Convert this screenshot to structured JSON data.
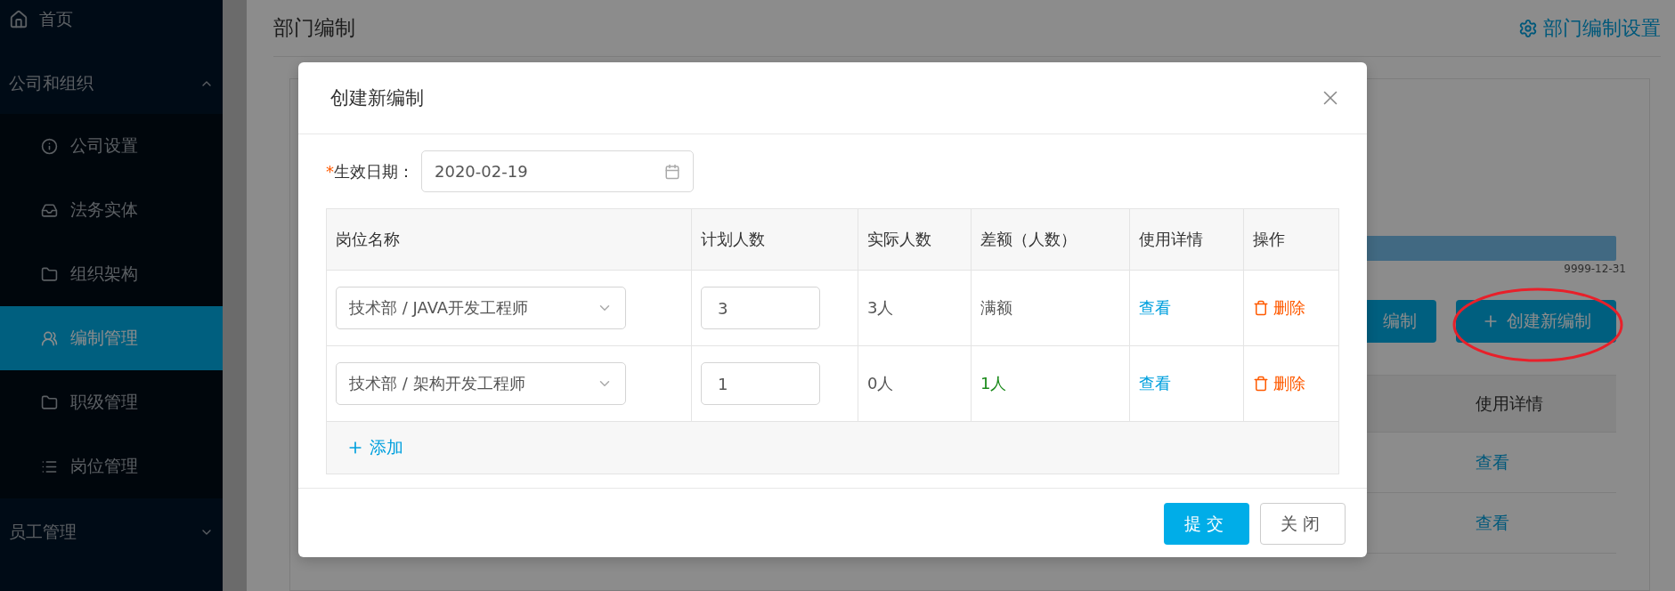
{
  "sidebar": {
    "items": [
      {
        "kind": "link",
        "label": "首页",
        "selected": false
      },
      {
        "kind": "group",
        "label": "公司和组织",
        "expanded": true,
        "children": [
          {
            "label": "公司设置",
            "selected": false
          },
          {
            "label": "法务实体",
            "selected": false
          },
          {
            "label": "组织架构",
            "selected": false
          },
          {
            "label": "编制管理",
            "selected": true
          },
          {
            "label": "职级管理",
            "selected": false
          },
          {
            "label": "岗位管理",
            "selected": false
          }
        ]
      },
      {
        "kind": "group",
        "label": "员工管理",
        "expanded": false
      }
    ]
  },
  "page": {
    "title": "部门编制",
    "settings_link": "部门编制设置",
    "timeline_end": "9999-12-31",
    "buttons": [
      "编制",
      "创建新编制"
    ],
    "table": {
      "columns": [
        "使用详情"
      ],
      "rows": [
        {
          "details": "查看"
        },
        {
          "details": "查看"
        }
      ]
    }
  },
  "modal": {
    "title": "创建新编制",
    "date_label": "生效日期：",
    "date_required_mark": "*",
    "date_value": "2020-02-19",
    "columns": [
      "岗位名称",
      "计划人数",
      "实际人数",
      "差额（人数）",
      "使用详情",
      "操作"
    ],
    "rows": [
      {
        "position": "技术部 / JAVA开发工程师",
        "planned": "3",
        "actual": "3人",
        "gap": "满额",
        "shortage": false,
        "details": "查看",
        "action": "删除"
      },
      {
        "position": "技术部 / 架构开发工程师",
        "planned": "1",
        "actual": "0人",
        "gap": "1人",
        "shortage": true,
        "details": "查看",
        "action": "删除"
      }
    ],
    "add_label": "添加",
    "submit": "提交",
    "close": "关闭"
  }
}
